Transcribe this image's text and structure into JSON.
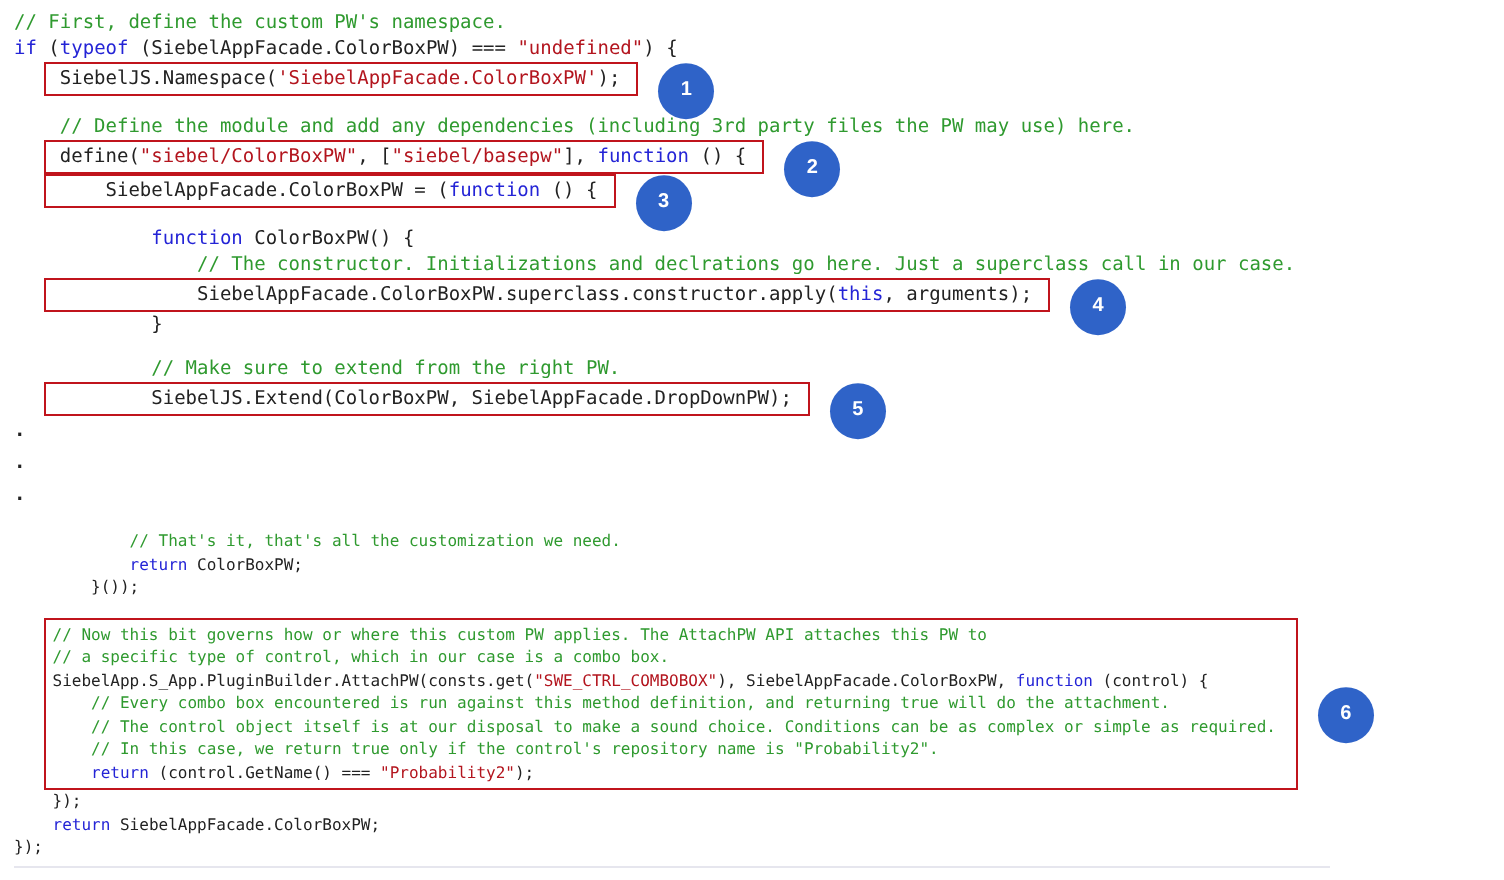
{
  "lines": [
    {
      "kind": "code",
      "tokens": [
        {
          "kind": "comment",
          "text": "// First, define the custom PW's namespace."
        }
      ]
    },
    {
      "kind": "code",
      "tokens": [
        {
          "kind": "keyword",
          "text": "if"
        },
        {
          "kind": "plain",
          "text": " ("
        },
        {
          "kind": "keyword",
          "text": "typeof"
        },
        {
          "kind": "plain",
          "text": " (SiebelAppFacade.ColorBoxPW) === "
        },
        {
          "kind": "string",
          "text": "\"undefined\""
        },
        {
          "kind": "plain",
          "text": ") {"
        }
      ]
    },
    {
      "kind": "annotation",
      "number": "1",
      "lines": [
        {
          "tokens": [
            {
              "kind": "plain",
              "text": "    SiebelJS.Namespace("
            },
            {
              "kind": "string",
              "text": "'SiebelAppFacade.ColorBoxPW'"
            },
            {
              "kind": "plain",
              "text": ");"
            }
          ]
        }
      ]
    },
    {
      "kind": "blank"
    },
    {
      "kind": "code",
      "tokens": [
        {
          "kind": "comment",
          "text": "    // Define the module and add any dependencies (including 3rd party files the PW may use) here."
        }
      ]
    },
    {
      "kind": "annotation",
      "number": "2",
      "lines": [
        {
          "tokens": [
            {
              "kind": "plain",
              "text": "    define("
            },
            {
              "kind": "string",
              "text": "\"siebel/ColorBoxPW\""
            },
            {
              "kind": "plain",
              "text": ", ["
            },
            {
              "kind": "string",
              "text": "\"siebel/basepw\""
            },
            {
              "kind": "plain",
              "text": "], "
            },
            {
              "kind": "keyword",
              "text": "function"
            },
            {
              "kind": "plain",
              "text": " () {"
            }
          ]
        }
      ]
    },
    {
      "kind": "annotation",
      "number": "3",
      "lines": [
        {
          "tokens": [
            {
              "kind": "plain",
              "text": "        SiebelAppFacade.ColorBoxPW = ("
            },
            {
              "kind": "keyword",
              "text": "function"
            },
            {
              "kind": "plain",
              "text": " () {"
            }
          ]
        }
      ]
    },
    {
      "kind": "blank"
    },
    {
      "kind": "code",
      "tokens": [
        {
          "kind": "keyword",
          "text": "            function"
        },
        {
          "kind": "plain",
          "text": " ColorBoxPW() {"
        }
      ]
    },
    {
      "kind": "code",
      "tokens": [
        {
          "kind": "comment",
          "text": "                // The constructor. Initializations and declrations go here. Just a superclass call in our case."
        }
      ]
    },
    {
      "kind": "annotation",
      "number": "4",
      "lines": [
        {
          "tokens": [
            {
              "kind": "plain",
              "text": "                SiebelAppFacade.ColorBoxPW.superclass.constructor.apply("
            },
            {
              "kind": "keyword",
              "text": "this"
            },
            {
              "kind": "plain",
              "text": ", arguments);"
            }
          ]
        }
      ]
    },
    {
      "kind": "code",
      "tokens": [
        {
          "kind": "plain",
          "text": "            }"
        }
      ]
    },
    {
      "kind": "blank"
    },
    {
      "kind": "code",
      "tokens": [
        {
          "kind": "comment",
          "text": "            // Make sure to extend from the right PW."
        }
      ]
    },
    {
      "kind": "annotation",
      "number": "5",
      "lines": [
        {
          "tokens": [
            {
              "kind": "plain",
              "text": "            SiebelJS.Extend(ColorBoxPW, SiebelAppFacade.DropDownPW);"
            }
          ]
        }
      ]
    },
    {
      "kind": "dot",
      "text": "."
    },
    {
      "kind": "dot",
      "text": "."
    },
    {
      "kind": "dot",
      "text": "."
    },
    {
      "kind": "blank"
    },
    {
      "kind": "code",
      "tokens": [
        {
          "kind": "comment",
          "text": "            // That's it, that's all the customization we need."
        }
      ]
    },
    {
      "kind": "code",
      "tokens": [
        {
          "kind": "keyword",
          "text": "            return"
        },
        {
          "kind": "plain",
          "text": " ColorBoxPW;"
        }
      ]
    },
    {
      "kind": "code",
      "tokens": [
        {
          "kind": "plain",
          "text": "        }());"
        }
      ]
    },
    {
      "kind": "blank"
    },
    {
      "kind": "annotation",
      "number": "6",
      "lines": [
        {
          "tokens": [
            {
              "kind": "comment",
              "text": "    // Now this bit governs how or where this custom PW applies. The AttachPW API attaches this PW to"
            }
          ]
        },
        {
          "tokens": [
            {
              "kind": "comment",
              "text": "    // a specific type of control, which in our case is a combo box."
            }
          ]
        },
        {
          "tokens": [
            {
              "kind": "plain",
              "text": "    SiebelApp.S_App.PluginBuilder.AttachPW(consts.get("
            },
            {
              "kind": "string",
              "text": "\"SWE_CTRL_COMBOBOX\""
            },
            {
              "kind": "plain",
              "text": "), SiebelAppFacade.ColorBoxPW, "
            },
            {
              "kind": "keyword",
              "text": "function"
            },
            {
              "kind": "plain",
              "text": " (control) {"
            }
          ]
        },
        {
          "tokens": [
            {
              "kind": "comment",
              "text": "        // Every combo box encountered is run against this method definition, and returning true will do the attachment."
            }
          ]
        },
        {
          "tokens": [
            {
              "kind": "comment",
              "text": "        // The control object itself is at our disposal to make a sound choice. Conditions can be as complex or simple as required."
            }
          ]
        },
        {
          "tokens": [
            {
              "kind": "comment",
              "text": "        // In this case, we return true only if the control's repository name is \"Probability2\"."
            }
          ]
        },
        {
          "tokens": [
            {
              "kind": "keyword",
              "text": "        return"
            },
            {
              "kind": "plain",
              "text": " (control.GetName() === "
            },
            {
              "kind": "string",
              "text": "\"Probability2\""
            },
            {
              "kind": "plain",
              "text": ");"
            }
          ]
        }
      ]
    },
    {
      "kind": "code",
      "tokens": [
        {
          "kind": "plain",
          "text": "    });"
        }
      ]
    },
    {
      "kind": "code",
      "tokens": [
        {
          "kind": "keyword",
          "text": "    return"
        },
        {
          "kind": "plain",
          "text": " SiebelAppFacade.ColorBoxPW;"
        }
      ]
    },
    {
      "kind": "code",
      "tokens": [
        {
          "kind": "plain",
          "text": "});"
        }
      ]
    }
  ]
}
